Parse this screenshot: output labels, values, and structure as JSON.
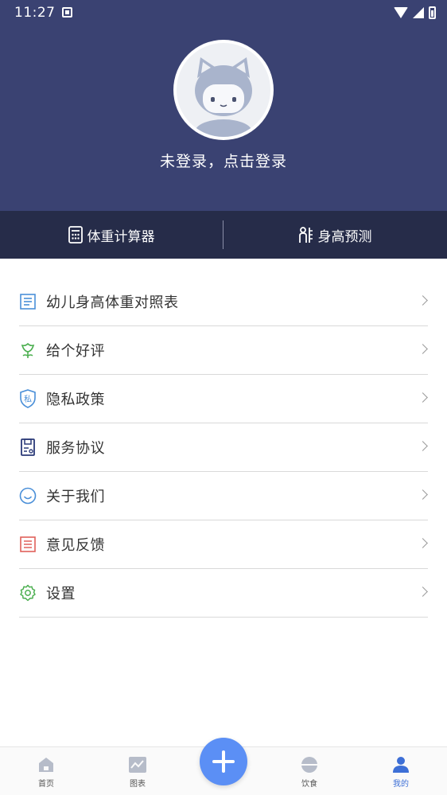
{
  "status_bar": {
    "time": "11:27"
  },
  "profile": {
    "login_prompt": "未登录，点击登录"
  },
  "tools": {
    "left": {
      "label": "体重计算器",
      "icon": "calculator-icon"
    },
    "right": {
      "label": "身高预测",
      "icon": "height-scale-icon"
    }
  },
  "menu": {
    "items": [
      {
        "label": "幼儿身高体重对照表",
        "icon": "table-icon",
        "color": "#4a8fd8"
      },
      {
        "label": "给个好评",
        "icon": "flower-icon",
        "color": "#4caf50"
      },
      {
        "label": "隐私政策",
        "icon": "privacy-shield-icon",
        "icon_text": "私",
        "color": "#4a8fd8"
      },
      {
        "label": "服务协议",
        "icon": "document-icon",
        "color": "#2b3a78"
      },
      {
        "label": "关于我们",
        "icon": "smile-icon",
        "color": "#4a8fd8"
      },
      {
        "label": "意见反馈",
        "icon": "feedback-icon",
        "color": "#e0605a"
      },
      {
        "label": "设置",
        "icon": "gear-icon",
        "color": "#4caf50"
      }
    ]
  },
  "bottom_nav": {
    "home": "首页",
    "chart": "图表",
    "diet": "饮食",
    "mine": "我的",
    "active": "我的",
    "active_color": "#3d6fd6"
  }
}
